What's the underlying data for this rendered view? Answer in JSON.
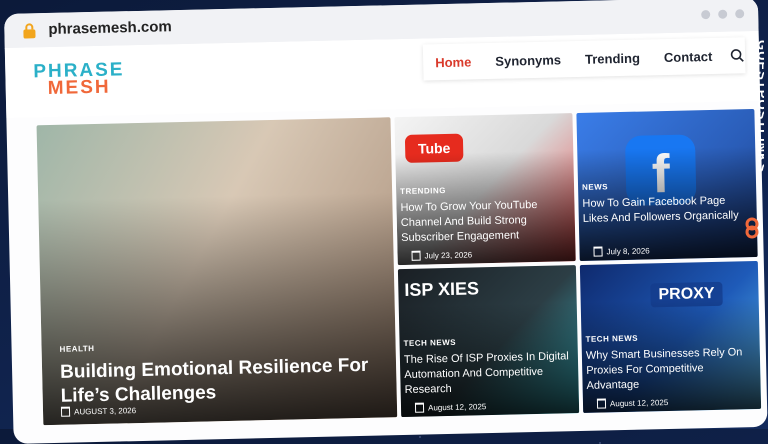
{
  "browser": {
    "url": "phrasemesh.com"
  },
  "logo": {
    "line1": "PHRASE",
    "line2": "MESH"
  },
  "nav": {
    "items": [
      "Home",
      "Synonyms",
      "Trending",
      "Contact"
    ]
  },
  "posts": {
    "main": {
      "category": "HEALTH",
      "title": "Building Emotional Resilience For Life’s Challenges",
      "date": "AUGUST 3, 2026"
    },
    "youtube": {
      "category": "TRENDING",
      "title": "How To Grow Your YouTube Channel And Build Strong Subscriber Engagement",
      "date": "July 23, 2026",
      "image_text": "Tube"
    },
    "facebook": {
      "category": "NEWS",
      "title": "How To Gain Facebook Page Likes And Followers Organically",
      "date": "July 8, 2026",
      "image_text": "f"
    },
    "isp": {
      "category": "TECH NEWS",
      "title": "The Rise Of ISP Proxies In Digital Automation And Competitive Research",
      "date": "August 12, 2025",
      "image_text": "ISP XIES"
    },
    "proxy": {
      "category": "TECH NEWS",
      "title": "Why Smart Businesses Rely On Proxies For Competitive Advantage",
      "date": "August 12, 2025",
      "image_text": "PROXY"
    }
  },
  "watermark": {
    "text": "GUESTPOSTLINKS"
  },
  "colors": {
    "accent": "#d93a2b",
    "logo_teal": "#2bb0c8",
    "logo_orange": "#f0683a"
  }
}
